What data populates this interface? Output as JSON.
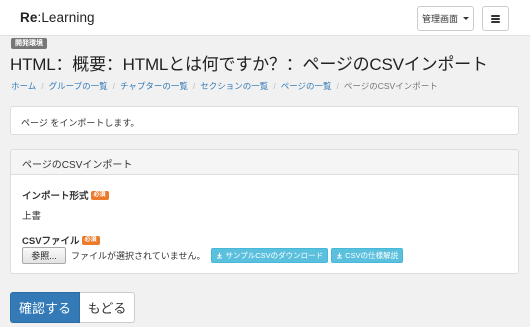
{
  "navbar": {
    "brand_bold": "Re",
    "brand_rest": ":Learning",
    "admin_label": "管理画面",
    "menu_icon": "hamburger-icon"
  },
  "env_badge": "開発環境",
  "page_title": "HTML：概要：HTMLとは何ですか？：ページのCSVインポート",
  "breadcrumb": {
    "items": [
      "ホーム",
      "グループの一覧",
      "チャプターの一覧",
      "セクションの一覧",
      "ページの一覧"
    ],
    "current": "ページのCSVインポート"
  },
  "alert": {
    "text": "ページ をインポートします。"
  },
  "panel": {
    "heading": "ページのCSVインポート",
    "import_format_label": "インポート形式",
    "import_format_required": "必須",
    "import_format_value": "上書",
    "csv_file_label": "CSVファイル",
    "csv_file_required": "必須",
    "browse_label": "参照...",
    "file_status": "ファイルが選択されていません。",
    "sample_download_label": "サンプルCSVのダウンロード",
    "spec_label": "CSVの仕様解説"
  },
  "actions": {
    "confirm_label": "確認する",
    "back_label": "もどる"
  },
  "colors": {
    "primary": "#337ab7",
    "info": "#5bc0de",
    "required": "#ec7a2a",
    "badge": "#777777"
  }
}
